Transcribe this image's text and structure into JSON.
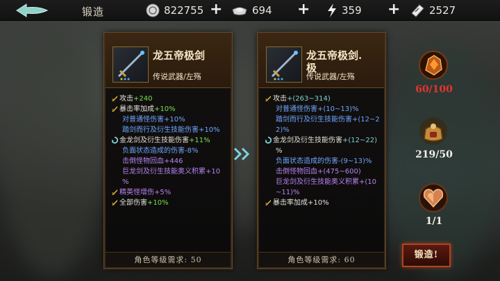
{
  "header": {
    "title": "锻造"
  },
  "currencies": [
    {
      "icon": "coin-icon",
      "value": "822755"
    },
    {
      "icon": "silver-ingot-icon",
      "value": "694"
    },
    {
      "icon": "lightning-icon",
      "value": "359"
    },
    {
      "icon": "ticket-icon",
      "value": "2527"
    }
  ],
  "current": {
    "name": "龙五帝极剑",
    "type": "传说武器/左殇",
    "stats": [
      {
        "icon": "sword-bullet-icon",
        "label": "攻击",
        "value": "+240",
        "color": "green"
      },
      {
        "icon": "sword-bullet-icon",
        "label": "暴击率加成",
        "value": "+10%",
        "color": "green"
      },
      {
        "icon": "",
        "label": "对普通怪伤害",
        "value": "+10%",
        "color": "blue"
      },
      {
        "icon": "",
        "label": "踏剑而行及衍生技能伤害",
        "value": "+10%",
        "color": "blue"
      },
      {
        "icon": "swirl-icon",
        "label": "金龙剑及衍生技能伤害",
        "value": "+11%",
        "color": "green"
      },
      {
        "icon": "",
        "label": "负面状态造成的伤害",
        "value": "-8%",
        "color": "blue"
      },
      {
        "icon": "",
        "label": "击倒怪物回血",
        "value": "+446",
        "color": "purple"
      },
      {
        "icon": "",
        "label": "巨龙剑及衍生技能奥义积累",
        "value": "+10",
        "color": "purple"
      },
      {
        "icon": "",
        "label": "%",
        "value": "",
        "color": "purple"
      },
      {
        "icon": "sword-bullet-icon",
        "label": "精英怪增伤",
        "value": "+5%",
        "color": "purple"
      },
      {
        "icon": "sword-bullet-icon",
        "label": "全部伤害",
        "value": "+10%",
        "color": "green"
      }
    ],
    "footer": "角色等级需求: 50"
  },
  "next": {
    "name": "龙五帝极剑.",
    "name_line2": "极",
    "type": "传说武器/左殇",
    "stats": [
      {
        "icon": "sword-bullet-icon",
        "label": "攻击",
        "value": "+(263~314)",
        "color": "teal"
      },
      {
        "icon": "",
        "label": "对普通怪伤害",
        "value": "+(10~13)%",
        "color": "blue"
      },
      {
        "icon": "",
        "label": "踏剑而行及衍生技能伤害",
        "value": "+(12~2",
        "color": "blue"
      },
      {
        "icon": "",
        "label": "2)%",
        "value": "",
        "color": "blue"
      },
      {
        "icon": "swirl-icon",
        "label": "金龙剑及衍生技能伤害",
        "value": "+(12~22)",
        "color": "teal"
      },
      {
        "icon": "",
        "label": "%",
        "value": "",
        "color": "teal"
      },
      {
        "icon": "",
        "label": "负面状态造成的伤害",
        "value": "-(9~13)%",
        "color": "blue"
      },
      {
        "icon": "",
        "label": "击倒怪物回血",
        "value": "+(475~600)",
        "color": "purple"
      },
      {
        "icon": "",
        "label": "巨龙剑及衍生技能奥义积累",
        "value": "+(10",
        "color": "purple"
      },
      {
        "icon": "",
        "label": "~11)%",
        "value": "",
        "color": "purple"
      },
      {
        "icon": "sword-bullet-icon",
        "label": "暴击率加成",
        "value": "+10%",
        "color": "white"
      }
    ],
    "footer": "角色等级需求: 60"
  },
  "materials": [
    {
      "icon": "fire-ore-icon",
      "count": "60/100",
      "color": "#e5342b"
    },
    {
      "icon": "treasure-bag-icon",
      "count": "219/50",
      "color": "#f2f0e8"
    },
    {
      "icon": "heart-gem-icon",
      "count": "1/1",
      "color": "#f2f0e8"
    }
  ],
  "forge_button": "锻造!",
  "colors": {
    "green": "#7ae04f",
    "blue": "#6fa5ff",
    "purple": "#b683f2",
    "teal": "#7fd2d0",
    "white": "#e5e2d8"
  }
}
